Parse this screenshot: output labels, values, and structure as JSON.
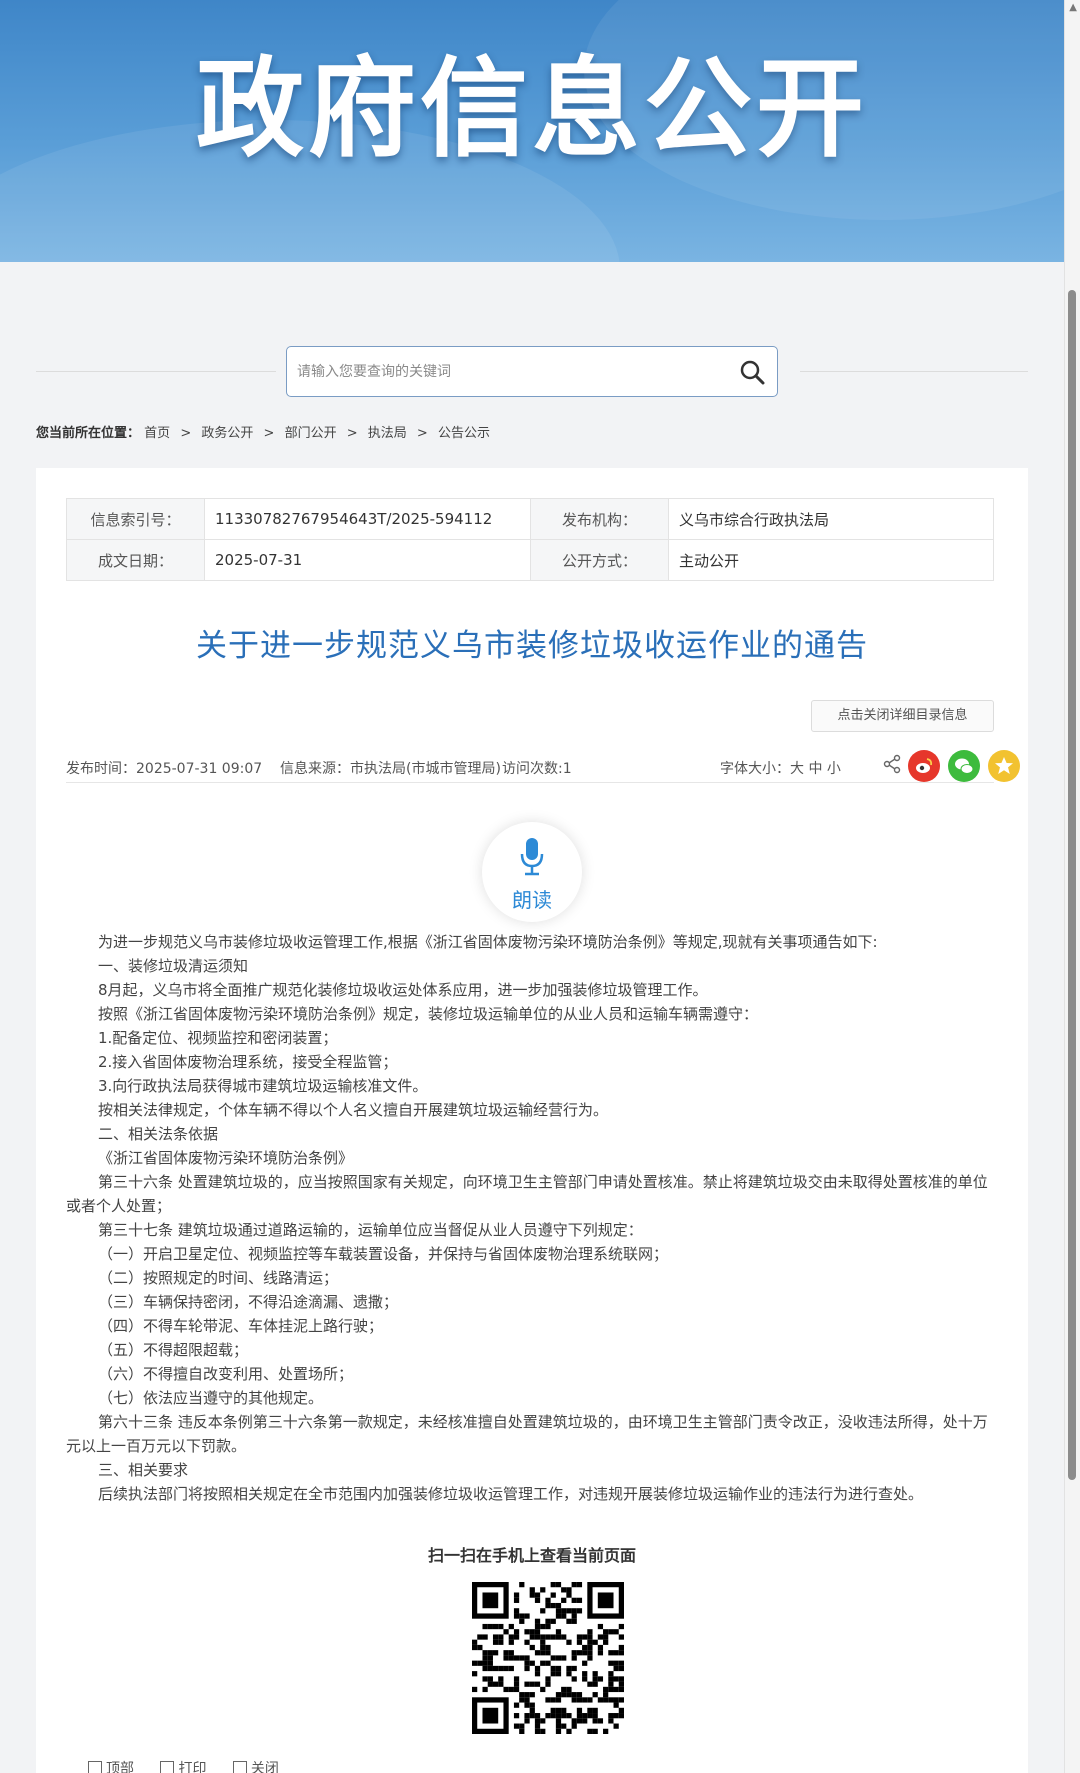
{
  "banner": {
    "title": "政府信息公开"
  },
  "search": {
    "placeholder": "请输入您要查询的关键词"
  },
  "breadcrumb": {
    "lead": "您当前所在位置：",
    "items": [
      "首页",
      "政务公开",
      "部门公开",
      "执法局",
      "公告公示"
    ],
    "separator": ">"
  },
  "meta": {
    "index_label": "信息索引号：",
    "index_value": "11330782767954643T/2025-594112",
    "org_label": "发布机构：",
    "org_value": "义乌市综合行政执法局",
    "date_label": "成文日期：",
    "date_value": "2025-07-31",
    "method_label": "公开方式：",
    "method_value": "主动公开"
  },
  "doc": {
    "title": "关于进一步规范义乌市装修垃圾收运作业的通告",
    "catalog_button": "点击关闭详细目录信息",
    "publish_time": "发布时间：2025-07-31 09:07",
    "source": "信息来源：市执法局(市城市管理局)",
    "visits": "访问次数:1",
    "font_size": "字体大小：大 中 小",
    "read_label": "朗读"
  },
  "body": [
    "为进一步规范义乌市装修垃圾收运管理工作,根据《浙江省固体废物污染环境防治条例》等规定,现就有关事项通告如下:",
    "一、装修垃圾清运须知",
    "8月起，义乌市将全面推广规范化装修垃圾收运处体系应用，进一步加强装修垃圾管理工作。",
    "按照《浙江省固体废物污染环境防治条例》规定，装修垃圾运输单位的从业人员和运输车辆需遵守：",
    "1.配备定位、视频监控和密闭装置；",
    "2.接入省固体废物治理系统，接受全程监管；",
    "3.向行政执法局获得城市建筑垃圾运输核准文件。",
    "按相关法律规定，个体车辆不得以个人名义擅自开展建筑垃圾运输经营行为。",
    "二、相关法条依据",
    "《浙江省固体废物污染环境防治条例》",
    "第三十六条  处置建筑垃圾的，应当按照国家有关规定，向环境卫生主管部门申请处置核准。禁止将建筑垃圾交由未取得处置核准的单位或者个人处置；",
    "第三十七条   建筑垃圾通过道路运输的，运输单位应当督促从业人员遵守下列规定：",
    "（一）开启卫星定位、视频监控等车载装置设备，并保持与省固体废物治理系统联网；",
    "（二）按照规定的时间、线路清运；",
    "（三）车辆保持密闭，不得沿途滴漏、遗撒；",
    "（四）不得车轮带泥、车体挂泥上路行驶；",
    "（五）不得超限超载；",
    "（六）不得擅自改变利用、处置场所；",
    "（七）依法应当遵守的其他规定。",
    "第六十三条   违反本条例第三十六条第一款规定，未经核准擅自处置建筑垃圾的，由环境卫生主管部门责令改正，没收违法所得，处十万元以上一百万元以下罚款。",
    "三、相关要求",
    "后续执法部门将按照相关规定在全市范围内加强装修垃圾收运管理工作，对违规开展装修垃圾运输作业的违法行为进行查处。"
  ],
  "qr": {
    "caption": "扫一扫在手机上查看当前页面"
  },
  "footer": {
    "top": "顶部",
    "print": "打印",
    "close": "关闭"
  },
  "colors": {
    "accent": "#2a6fb8",
    "banner": "#4a90d0"
  }
}
